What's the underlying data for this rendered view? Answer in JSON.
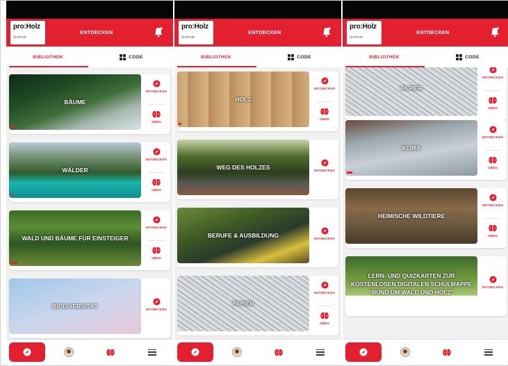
{
  "brand": {
    "logo_main": "pro:Holz",
    "logo_sub": "tirol/nat"
  },
  "header": {
    "title": "ENTDECKEN"
  },
  "tabs": {
    "library": "BIBLIOTHEK",
    "code": "CODE"
  },
  "actions": {
    "discover": "ENTDECKEN",
    "practice": "ÜBEN"
  },
  "colors": {
    "accent": "#e3202f",
    "status_bar": "#050505",
    "background": "#f1f1f1"
  },
  "icons": {
    "bell": "bell-icon",
    "compass": "compass-icon",
    "brain": "brain-icon",
    "grid": "grid-icon",
    "avatar": "avatar-icon",
    "menu": "menu-icon"
  },
  "screens": [
    {
      "cards": [
        {
          "label": "BÄUME",
          "progress": 0.03,
          "has_practice": true
        },
        {
          "label": "WÄLDER",
          "progress": 0.02,
          "has_practice": true
        },
        {
          "label": "WALD UND BÄUME FÜR EINSTEIGER",
          "progress": 0.05,
          "has_practice": true
        },
        {
          "label": "BIODIVERSITÄT",
          "progress": 0,
          "has_practice": false
        }
      ]
    },
    {
      "cards": [
        {
          "label": "HOLZ",
          "progress": 0.02,
          "has_practice": true
        },
        {
          "label": "WEG DES HOLZES",
          "progress": 0,
          "has_practice": false
        },
        {
          "label": "BERUFE & AUSBILDUNG",
          "progress": 0,
          "has_practice": false
        },
        {
          "label": "PAPIER",
          "progress": 0,
          "has_practice": true
        }
      ]
    },
    {
      "cards": [
        {
          "label": "PAPIER",
          "progress": 0,
          "has_practice": true
        },
        {
          "label": "KLIMA",
          "progress": 0.04,
          "has_practice": true
        },
        {
          "label": "HEIMISCHE WILDTIERE",
          "progress": 0,
          "has_practice": true
        },
        {
          "label": "LERN- UND QUIZKARTEN ZUR KOSTENLOSEN DIGITALEN SCHULMAPPE \"RUND UM WALD UND HOLZ\"",
          "progress": 0,
          "has_practice": false
        }
      ]
    }
  ]
}
